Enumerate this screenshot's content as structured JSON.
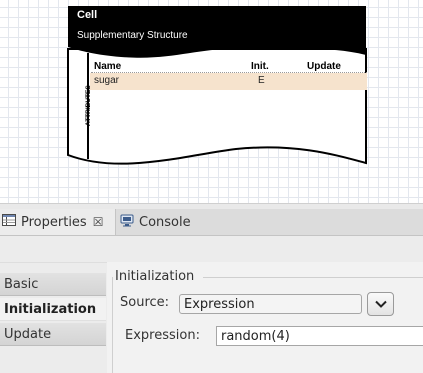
{
  "canvas": {
    "cell": {
      "title": "Cell",
      "subtitle": "Supplementary Structure",
      "section_label": "ATTRIBUTES",
      "columns": [
        "Name",
        "Init.",
        "Update"
      ],
      "attributes": [
        {
          "name": "sugar",
          "init": "E",
          "update": ""
        }
      ]
    }
  },
  "tabs": [
    {
      "label": "Properties",
      "icon": "properties-icon",
      "closable": true,
      "active": true
    },
    {
      "label": "Console",
      "icon": "console-icon",
      "closable": false,
      "active": false
    }
  ],
  "properties": {
    "left_tabs": [
      "Basic",
      "Initialization",
      "Update"
    ],
    "active_tab": "Initialization",
    "section_title": "Initialization",
    "source": {
      "label": "Source:",
      "value": "Expression"
    },
    "expression": {
      "label": "Expression:",
      "value": "random(4)"
    }
  },
  "colors": {
    "header_fill": "#000000",
    "row_highlight": "#f6e3cd",
    "grid": "#e3e7ee",
    "panel_bg": "#ececec"
  }
}
